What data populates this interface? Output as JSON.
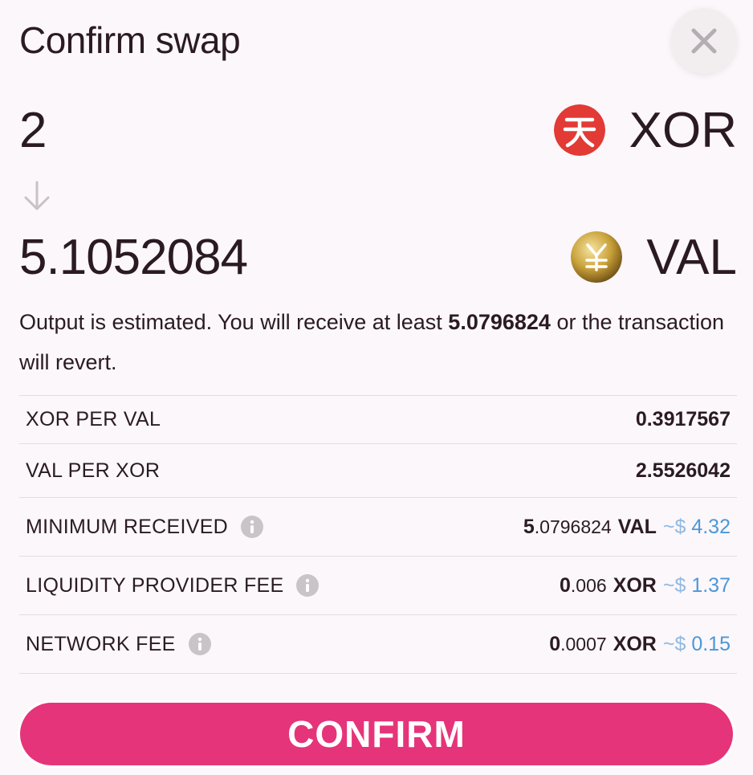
{
  "modal": {
    "title": "Confirm swap",
    "close_icon": "close-icon"
  },
  "from": {
    "amount": "2",
    "symbol": "XOR",
    "icon": "xor-token-icon",
    "icon_color": "#e23a35"
  },
  "to": {
    "amount": "5.1052084",
    "symbol": "VAL",
    "icon": "val-token-icon",
    "icon_color": "#c9a13a"
  },
  "arrow_icon": "arrow-down-icon",
  "note": {
    "prefix": "Output is estimated. You will receive at least",
    "amount": "5.0796824",
    "suffix": "or the transaction will revert."
  },
  "details": [
    {
      "label": "XOR PER VAL",
      "value": "0.3917567",
      "info": false
    },
    {
      "label": "VAL PER XOR",
      "value": "2.5526042",
      "info": false
    },
    {
      "label": "MINIMUM RECEIVED",
      "info": true,
      "int": "5",
      "frac": ".0796824",
      "symbol": "VAL",
      "fiat_tilde": "~$",
      "fiat": " 4.32"
    },
    {
      "label": "LIQUIDITY PROVIDER FEE",
      "info": true,
      "int": "0",
      "frac": ".006",
      "symbol": "XOR",
      "fiat_tilde": "~$",
      "fiat": " 1.37"
    },
    {
      "label": "NETWORK FEE",
      "info": true,
      "int": "0",
      "frac": ".0007",
      "symbol": "XOR",
      "fiat_tilde": "~$",
      "fiat": " 0.15"
    }
  ],
  "confirm_label": "CONFIRM",
  "colors": {
    "accent": "#e5347a",
    "fiat": "#4c97d8",
    "text": "#2b1a24"
  }
}
